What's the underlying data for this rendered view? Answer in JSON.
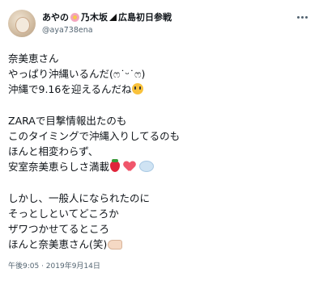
{
  "author": {
    "display_name_prefix": "あやの",
    "display_name_suffix": "乃木坂",
    "display_name_tail": "広島初日参戦",
    "handle": "@aya738ena"
  },
  "tweet": {
    "lines": [
      "奈美恵さん",
      "やっぱり沖縄いるんだ(ෆ˙ᵕ˙ෆ)",
      "沖縄で9.16を迎えるんだね",
      "",
      "ZARAで目撃情報出たのも",
      "このタイミングで沖縄入りしてるのも",
      "ほんと相変わらず、",
      "安室奈美恵らしさ満載",
      "",
      "しかし、一般人になられたのに",
      "そっとしといてどころか",
      "ザワつかせてるところ",
      "ほんと奈美恵さん(笑)"
    ]
  },
  "meta": {
    "timestamp": "午後9:05 · 2019年9月14日"
  },
  "icons": {
    "more": "more-horizontal-icon",
    "crying_face": "crying-face-icon",
    "strawberry": "strawberry-icon",
    "heart": "heart-icon",
    "thought_bubble": "thought-bubble-icon",
    "pointing_hand": "pointing-hand-icon"
  }
}
